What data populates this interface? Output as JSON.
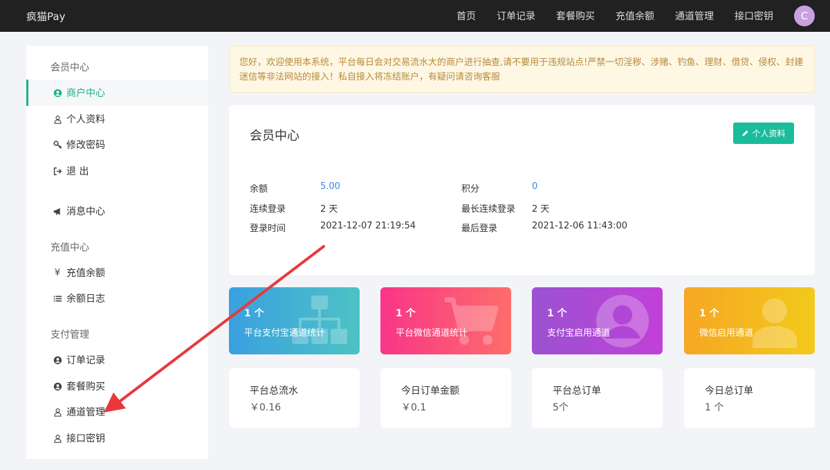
{
  "brand": "疯猫Pay",
  "nav": [
    "首页",
    "订单记录",
    "套餐购买",
    "充值余额",
    "通道管理",
    "接口密钥"
  ],
  "user_initial": "C",
  "sidebar": {
    "sections": {
      "member": "会员中心",
      "recharge": "充值中心",
      "payment": "支付管理"
    },
    "items": {
      "merchant": "商户中心",
      "profile": "个人资料",
      "password": "修改密码",
      "logout": "退 出",
      "messages": "消息中心",
      "recharge_balance": "充值余额",
      "balance_log": "余额日志",
      "orders": "订单记录",
      "packages": "套餐购买",
      "channels": "通道管理",
      "api_key": "接口密钥"
    }
  },
  "notice": "您好，欢迎使用本系统，平台每日会对交易流水大的商户进行抽查,请不要用于违规站点!严禁一切淫秽、涉赌、钓鱼、理财、借贷、侵权、封建迷信等非法网站的接入！私自接入将冻结账户，有疑问请咨询客服",
  "member_card": {
    "title": "会员中心",
    "profile_button": "个人资料",
    "balance_label": "余额",
    "balance_value": "5.00",
    "points_label": "积分",
    "points_value": "0",
    "streak_label": "连续登录",
    "streak_value": "2 天",
    "longest_label": "最长连续登录",
    "longest_value": "2 天",
    "login_time_label": "登录时间",
    "login_time_value": "2021-12-07 21:19:54",
    "last_login_label": "最后登录",
    "last_login_value": "2021-12-06 11:43:00"
  },
  "tiles": [
    {
      "count": "1 个",
      "label": "平台支付宝通道统计"
    },
    {
      "count": "1 个",
      "label": "平台微信通道统计"
    },
    {
      "count": "1 个",
      "label": "支付宝启用通道"
    },
    {
      "count": "1 个",
      "label": "微信启用通道"
    }
  ],
  "summary": [
    {
      "title": "平台总流水",
      "value": "￥0.16"
    },
    {
      "title": "今日订单金额",
      "value": "￥0.1"
    },
    {
      "title": "平台总订单",
      "value": "5个"
    },
    {
      "title": "今日总订单",
      "value": "1 个"
    }
  ],
  "colors": {
    "accent": "#16b389",
    "button": "#1abc9c",
    "link_value": "#3a8ad8",
    "annotation_arrow": "#e8383d"
  }
}
